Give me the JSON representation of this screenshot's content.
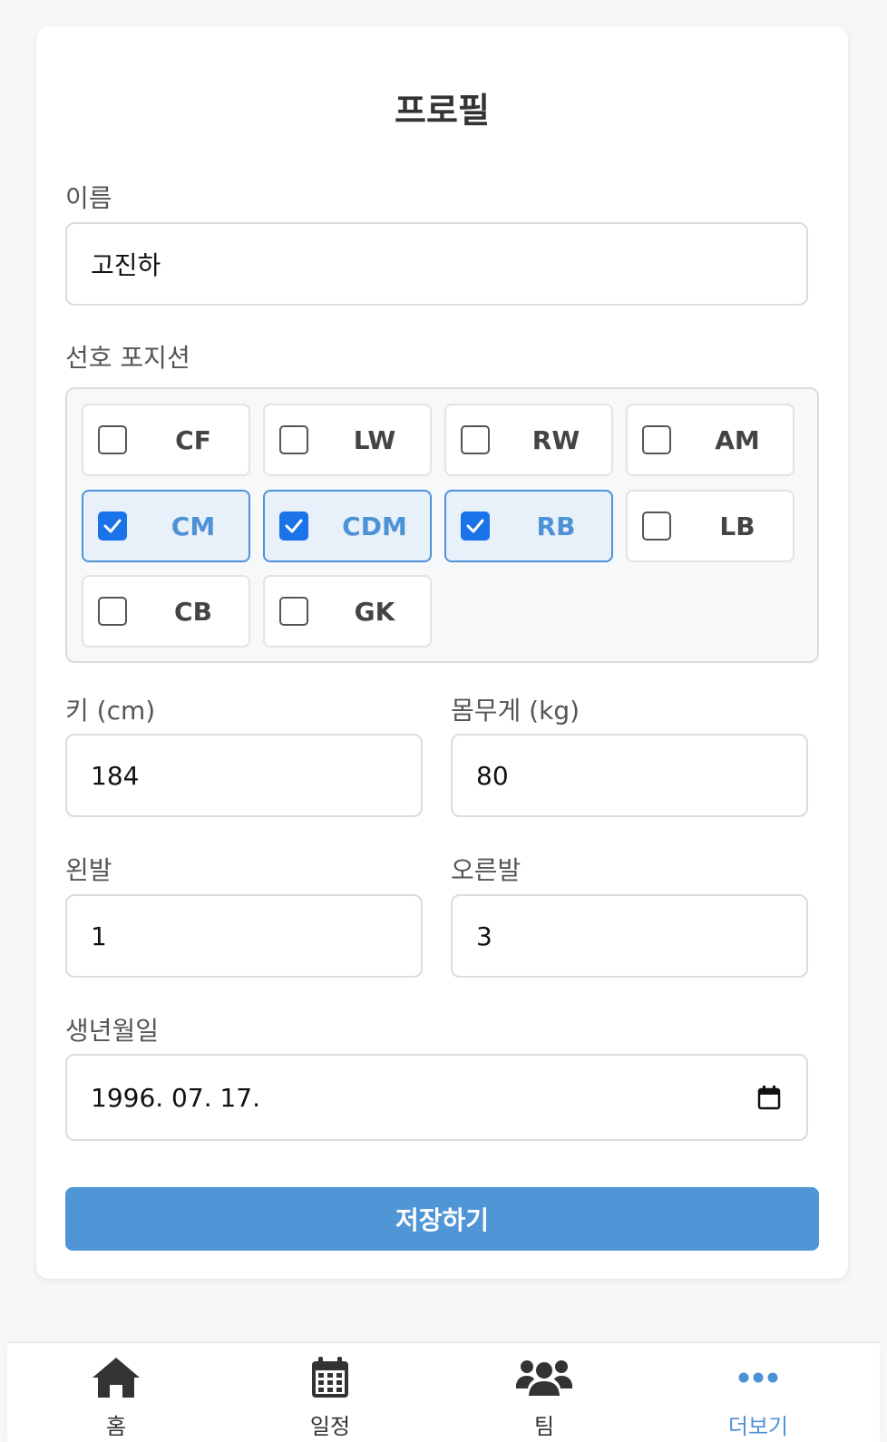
{
  "page": {
    "title": "프로필"
  },
  "form": {
    "name_label": "이름",
    "name_value": "고진하",
    "positions_label": "선호 포지션",
    "positions": [
      {
        "label": "CF",
        "checked": false
      },
      {
        "label": "LW",
        "checked": false
      },
      {
        "label": "RW",
        "checked": false
      },
      {
        "label": "AM",
        "checked": false
      },
      {
        "label": "CM",
        "checked": true
      },
      {
        "label": "CDM",
        "checked": true
      },
      {
        "label": "RB",
        "checked": true
      },
      {
        "label": "LB",
        "checked": false
      },
      {
        "label": "CB",
        "checked": false
      },
      {
        "label": "GK",
        "checked": false
      }
    ],
    "height_label": "키 (cm)",
    "height_value": "184",
    "weight_label": "몸무게 (kg)",
    "weight_value": "80",
    "left_foot_label": "왼발",
    "left_foot_value": "1",
    "right_foot_label": "오른발",
    "right_foot_value": "3",
    "birthdate_label": "생년월일",
    "birthdate_value": "1996. 07. 17.",
    "save_label": "저장하기"
  },
  "nav": {
    "items": [
      {
        "label": "홈",
        "icon": "home-icon",
        "active": false
      },
      {
        "label": "일정",
        "icon": "calendar-icon",
        "active": false
      },
      {
        "label": "팀",
        "icon": "users-icon",
        "active": false
      },
      {
        "label": "더보기",
        "icon": "more-icon",
        "active": true
      }
    ]
  },
  "colors": {
    "accent": "#5096d6",
    "checkbox": "#1a73e8",
    "active_nav": "#4e92d6"
  }
}
